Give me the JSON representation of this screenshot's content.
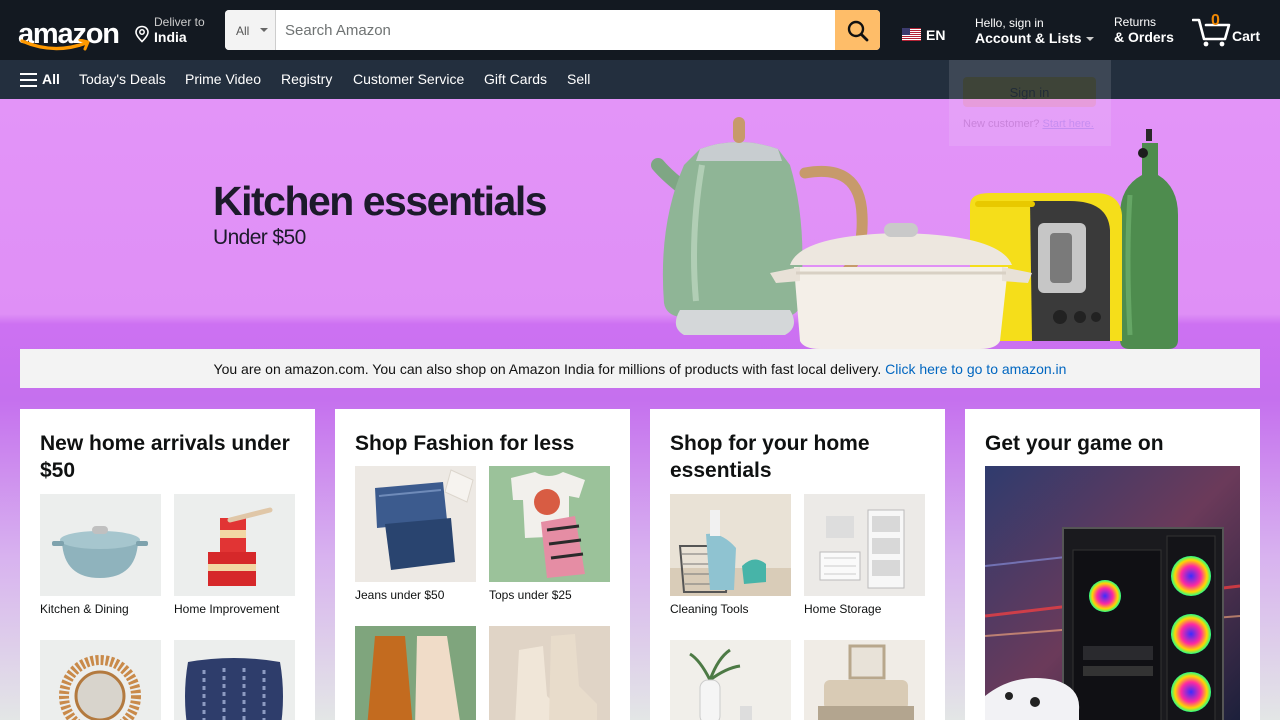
{
  "colors": {
    "nav": "#131921",
    "subnav": "#232f3e",
    "search_button": "#febd69",
    "accent": "#f08804",
    "hero": "#e394f8",
    "link": "#0066c0"
  },
  "header": {
    "logo": "amazon",
    "deliver": {
      "line1": "Deliver to",
      "line2": "India",
      "icon": "location-pin-icon"
    },
    "search": {
      "category": "All",
      "placeholder": "Search Amazon",
      "value": "",
      "icon": "search-icon"
    },
    "language": {
      "code": "EN",
      "flag": "us-flag-icon"
    },
    "account": {
      "line1": "Hello, sign in",
      "line2": "Account & Lists"
    },
    "returns": {
      "line1": "Returns",
      "line2": "& Orders"
    },
    "cart": {
      "count": "0",
      "label": "Cart",
      "icon": "cart-icon"
    }
  },
  "subnav": {
    "all_label": "All",
    "items": [
      "Today's Deals",
      "Prime Video",
      "Registry",
      "Customer Service",
      "Gift Cards",
      "Sell"
    ]
  },
  "signin_flyout": {
    "button": "Sign in",
    "new_customer": "New customer?",
    "start_here": "Start here."
  },
  "hero": {
    "title": "Kitchen essentials",
    "subtitle": "Under $50"
  },
  "notice": {
    "text": "You are on amazon.com. You can also shop on Amazon India for millions of products with fast local delivery.",
    "link": "Click here to go to amazon.in"
  },
  "cards": [
    {
      "title": "New home arrivals under $50",
      "tiles": [
        "Kitchen & Dining",
        "Home Improvement",
        "",
        ""
      ]
    },
    {
      "title": "Shop Fashion for less",
      "tiles": [
        "Jeans under $50",
        "Tops under $25",
        "",
        ""
      ]
    },
    {
      "title": "Shop for your home essentials",
      "tiles": [
        "Cleaning Tools",
        "Home Storage",
        "",
        ""
      ]
    },
    {
      "title": "Get your game on"
    }
  ]
}
